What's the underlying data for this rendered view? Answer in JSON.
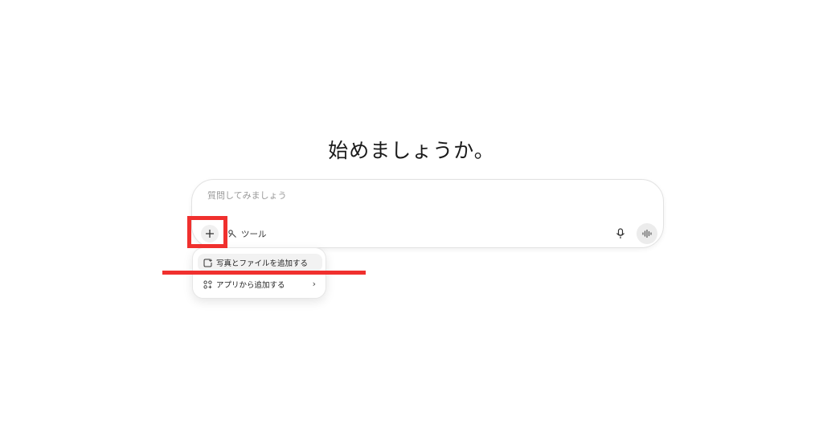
{
  "headline": "始めましょうか。",
  "composer": {
    "placeholder": "質問してみましょう",
    "tools_label": "ツール"
  },
  "menu": {
    "items": [
      {
        "label": "写真とファイルを追加する",
        "icon": "attach-photo-icon"
      },
      {
        "label": "アプリから追加する",
        "icon": "apps-grid-icon",
        "has_submenu": true
      }
    ]
  },
  "annotations": {
    "accent_color": "#f0302e"
  }
}
